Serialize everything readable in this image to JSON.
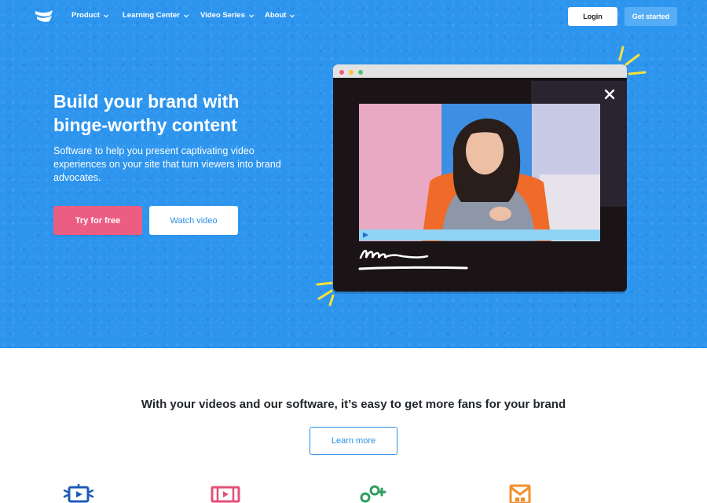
{
  "nav": {
    "items": [
      {
        "label": "Product"
      },
      {
        "label": "Learning Center"
      },
      {
        "label": "Video Series"
      },
      {
        "label": "About"
      }
    ],
    "login_label": "Login",
    "get_started_label": "Get started"
  },
  "hero": {
    "title_line1": "Build your brand with",
    "title_line2": "binge-worthy content",
    "subtitle": "Software to help you present captivating video experiences on your site that turn viewers into brand advocates.",
    "try_label": "Try for free",
    "watch_label": "Watch video"
  },
  "section": {
    "tagline": "With your videos and our software, it’s easy to get more fans for your brand",
    "learn_label": "Learn more"
  },
  "features": [
    {
      "icon": "video-screen-icon",
      "color": "#1e5bb8"
    },
    {
      "icon": "film-strip-icon",
      "color": "#e44f77"
    },
    {
      "icon": "add-users-icon",
      "color": "#2f9e5f"
    },
    {
      "icon": "mail-icon",
      "color": "#f0902c"
    }
  ],
  "colors": {
    "hero_bg": "#2d95ee",
    "primary_pink": "#ec5d82",
    "accent_blue": "#2d8fe6",
    "get_started_bg": "#55aef5"
  }
}
